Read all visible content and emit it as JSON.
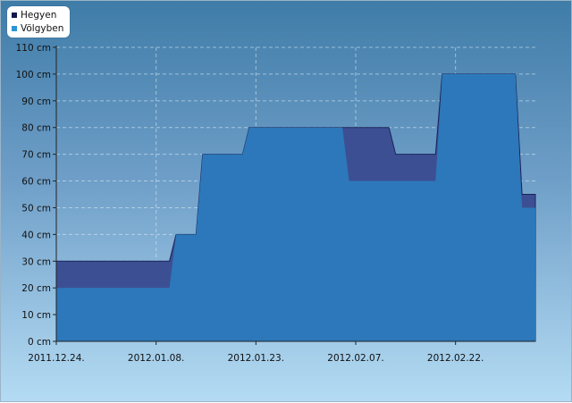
{
  "chart_data": {
    "type": "area",
    "title": "",
    "xlabel": "",
    "ylabel": "",
    "x_ticks": [
      "2011.12.24.",
      "2012.01.08.",
      "2012.01.23.",
      "2012.02.07.",
      "2012.02.22."
    ],
    "y_ticks": [
      "0 cm",
      "10 cm",
      "20 cm",
      "30 cm",
      "40 cm",
      "50 cm",
      "60 cm",
      "70 cm",
      "80 cm",
      "90 cm",
      "100 cm",
      "110 cm"
    ],
    "ylim": [
      0,
      110
    ],
    "xlim": [
      "2011-12-24",
      "2012-03-04"
    ],
    "grid": true,
    "legend_position": "top-left",
    "series": [
      {
        "name": "Hegyen",
        "color": "#3d4f93",
        "points": [
          [
            "2011-12-24",
            30
          ],
          [
            "2012-01-10",
            30
          ],
          [
            "2012-01-11",
            40
          ],
          [
            "2012-01-14",
            40
          ],
          [
            "2012-01-15",
            70
          ],
          [
            "2012-01-21",
            70
          ],
          [
            "2012-01-22",
            80
          ],
          [
            "2012-02-06",
            80
          ],
          [
            "2012-02-12",
            80
          ],
          [
            "2012-02-13",
            70
          ],
          [
            "2012-02-19",
            70
          ],
          [
            "2012-02-20",
            100
          ],
          [
            "2012-03-02",
            100
          ],
          [
            "2012-03-03",
            55
          ],
          [
            "2012-03-04",
            55
          ]
        ]
      },
      {
        "name": "Völgyben",
        "color": "#2c78ba",
        "points": [
          [
            "2011-12-24",
            20
          ],
          [
            "2012-01-10",
            20
          ],
          [
            "2012-01-11",
            40
          ],
          [
            "2012-01-14",
            40
          ],
          [
            "2012-01-15",
            70
          ],
          [
            "2012-01-21",
            70
          ],
          [
            "2012-01-22",
            80
          ],
          [
            "2012-02-05",
            80
          ],
          [
            "2012-02-06",
            60
          ],
          [
            "2012-02-19",
            60
          ],
          [
            "2012-02-20",
            100
          ],
          [
            "2012-03-02",
            100
          ],
          [
            "2012-03-03",
            50
          ],
          [
            "2012-03-04",
            50
          ]
        ]
      }
    ]
  }
}
